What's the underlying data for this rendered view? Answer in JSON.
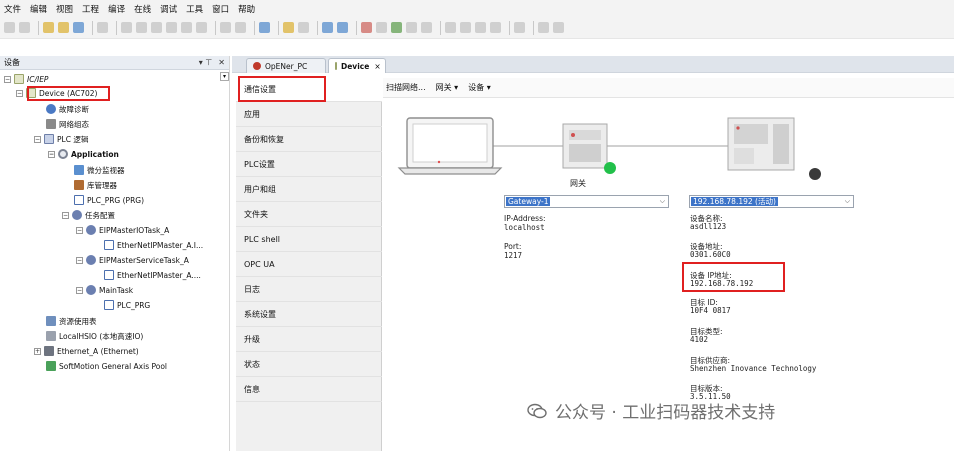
{
  "menu": [
    "文件",
    "编辑",
    "视图",
    "工程",
    "编译",
    "在线",
    "调试",
    "工具",
    "窗口",
    "帮助"
  ],
  "device_panel": {
    "title": "设备",
    "pin_glyph": "▾ ⊤",
    "close_glyph": "✕",
    "tree": [
      {
        "label": "IC/IEP",
        "icon": "project-icon"
      },
      {
        "label": "Device (AC702)",
        "icon": "device-icon"
      },
      {
        "label": "故障诊断",
        "icon": "diagnosis-icon"
      },
      {
        "label": "网络组态",
        "icon": "network-config-icon"
      },
      {
        "label": "PLC 逻辑",
        "icon": "plc-logic-icon"
      },
      {
        "label": "Application",
        "icon": "application-icon"
      },
      {
        "label": "微分监视器",
        "icon": "monitor-icon"
      },
      {
        "label": "库管理器",
        "icon": "library-manager-icon"
      },
      {
        "label": "PLC_PRG (PRG)",
        "icon": "program-icon"
      },
      {
        "label": "任务配置",
        "icon": "task-config-icon"
      },
      {
        "label": "EIPMasterIOTask_A",
        "icon": "task-icon"
      },
      {
        "label": "EtherNetIPMaster_A.I...",
        "icon": "program-icon"
      },
      {
        "label": "EIPMasterServiceTask_A",
        "icon": "task-icon"
      },
      {
        "label": "EtherNetIPMaster_A....",
        "icon": "program-icon"
      },
      {
        "label": "MainTask",
        "icon": "task-icon"
      },
      {
        "label": "PLC_PRG",
        "icon": "program-icon"
      },
      {
        "label": "资源使用表",
        "icon": "resource-icon"
      },
      {
        "label": "LocalHSIO (本地高速IO)",
        "icon": "io-icon"
      },
      {
        "label": "Ethernet_A (Ethernet)",
        "icon": "ethernet-icon"
      },
      {
        "label": "SoftMotion General Axis Pool",
        "icon": "axis-pool-icon"
      }
    ]
  },
  "tabs": [
    {
      "label": "OpENer_PC",
      "active": false
    },
    {
      "label": "Device",
      "active": true
    }
  ],
  "side_nav": [
    "通信设置",
    "应用",
    "备份和恢复",
    "PLC设置",
    "用户和组",
    "文件夹",
    "PLC shell",
    "OPC UA",
    "日志",
    "系统设置",
    "升级",
    "状态",
    "信息"
  ],
  "content_toolbar": {
    "scan": "扫描网络...",
    "gateway": "网关 ▾",
    "device": "设备 ▾"
  },
  "gateway": {
    "caption": "网关",
    "selected": "Gateway-1",
    "ip_label": "IP-Address:",
    "ip_value": "localhost",
    "port_label": "Port:",
    "port_value": "1217"
  },
  "device": {
    "selected": "192.168.78.192 (活动)",
    "fields": [
      {
        "label": "设备名称:",
        "value": "asdll123"
      },
      {
        "label": "设备地址:",
        "value": "0301.60C0"
      },
      {
        "label": "设备 IP地址:",
        "value": "192.168.78.192"
      },
      {
        "label": "目标 ID:",
        "value": "10F4 0817"
      },
      {
        "label": "目标类型:",
        "value": "4102"
      },
      {
        "label": "目标供应商:",
        "value": "Shenzhen Inovance Technology"
      },
      {
        "label": "目标版本:",
        "value": "3.5.11.50"
      }
    ]
  },
  "watermark": "公众号 · 工业扫码器技术支持",
  "colors": {
    "highlight_box": "#e02020",
    "selection": "#3d74c8",
    "status_green": "#22c04a",
    "status_dark": "#3a3a3a"
  }
}
